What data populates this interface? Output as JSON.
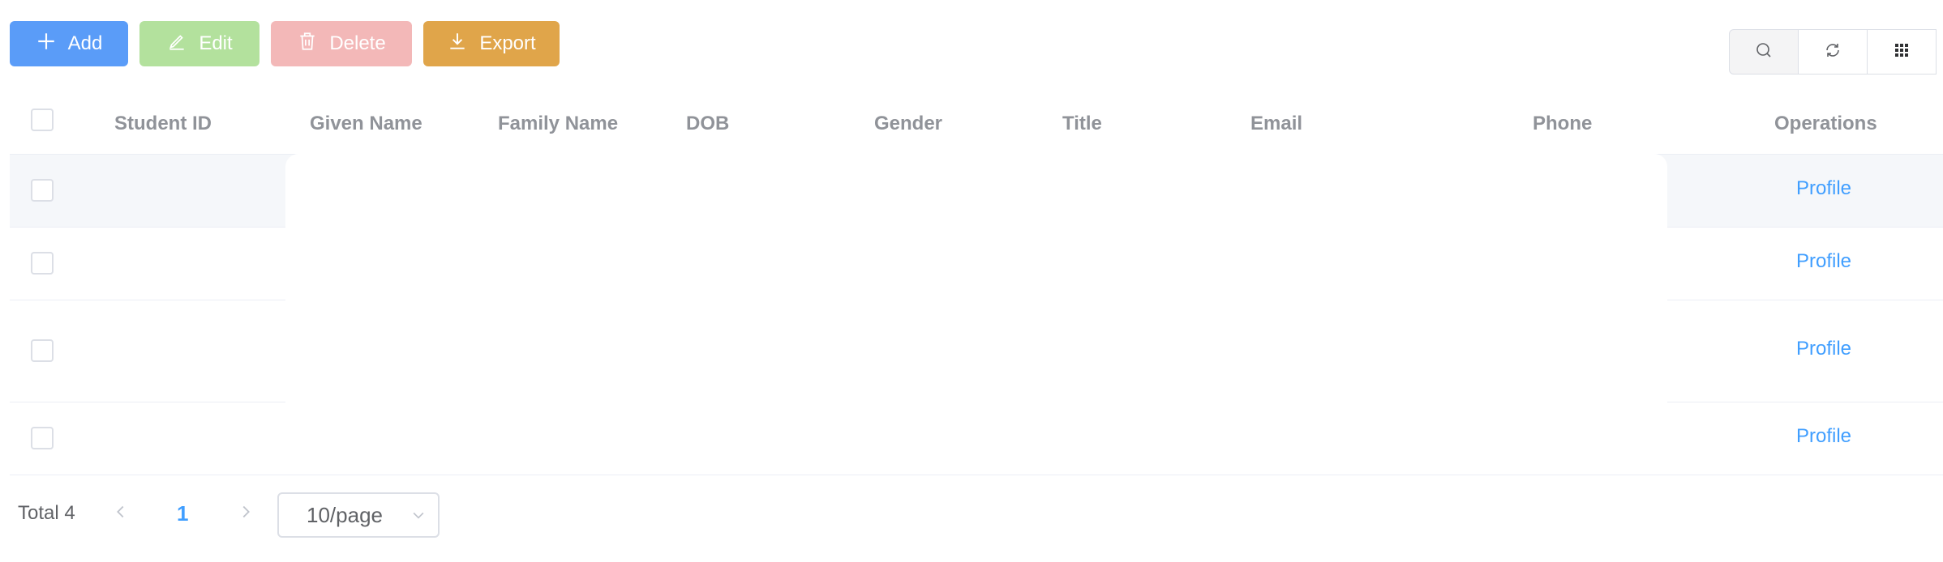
{
  "toolbar": {
    "add_label": "Add",
    "edit_label": "Edit",
    "delete_label": "Delete",
    "export_label": "Export",
    "colors": {
      "add": "#5a9cf8",
      "edit": "#b3e19d",
      "delete": "#f3b8b8",
      "export": "#e0a54a"
    }
  },
  "tools": [
    "search-icon",
    "refresh-icon",
    "columns-grid-icon"
  ],
  "table": {
    "columns": [
      "Student ID",
      "Given Name",
      "Family Name",
      "DOB",
      "Gender",
      "Title",
      "Email",
      "Phone",
      "Operations"
    ],
    "rows": [
      {
        "operation": "Profile"
      },
      {
        "operation": "Profile"
      },
      {
        "operation": "Profile"
      },
      {
        "operation": "Profile"
      }
    ]
  },
  "pagination": {
    "total": "Total 4",
    "current_page": "1",
    "page_size": "10/page"
  },
  "link_color": "#409eff"
}
